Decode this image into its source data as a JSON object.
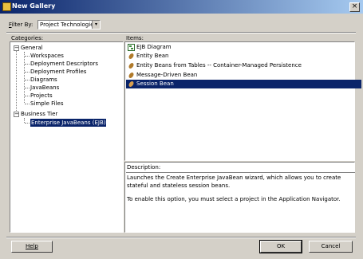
{
  "window": {
    "title": "New Gallery",
    "close_glyph": "×"
  },
  "filter": {
    "label_prefix": "",
    "label_accel": "F",
    "label_rest": "ilter By:",
    "value": "Project Technologies",
    "arrow": "▾"
  },
  "categories": {
    "label": "Categories:",
    "tree": [
      {
        "label": "General",
        "expander": "−"
      },
      {
        "label": "Workspaces"
      },
      {
        "label": "Deployment Descriptors"
      },
      {
        "label": "Deployment Profiles"
      },
      {
        "label": "Diagrams"
      },
      {
        "label": "JavaBeans"
      },
      {
        "label": "Projects"
      },
      {
        "label": "Simple Files"
      },
      {
        "label": "Business Tier",
        "expander": "−"
      },
      {
        "label": "Enterprise JavaBeans (EJB)"
      }
    ]
  },
  "items": {
    "label": "Items:",
    "list": [
      {
        "label": "EJB Diagram",
        "icon": "diagram-icon"
      },
      {
        "label": "Entity Bean",
        "icon": "bean-icon"
      },
      {
        "label": "Entity Beans from Tables -- Container-Managed Persistence",
        "icon": "bean-icon"
      },
      {
        "label": "Message-Driven Bean",
        "icon": "bean-icon"
      },
      {
        "label": "Session Bean",
        "icon": "bean-icon"
      }
    ],
    "selected_index": 4
  },
  "description": {
    "label": "Description:",
    "text1": "Launches the Create Enterprise JavaBean wizard, which allows you to create stateful and stateless session beans.",
    "text2": "To enable this option, you must select a project in the Application Navigator."
  },
  "buttons": {
    "help": "Help",
    "ok": "OK",
    "cancel": "Cancel"
  }
}
